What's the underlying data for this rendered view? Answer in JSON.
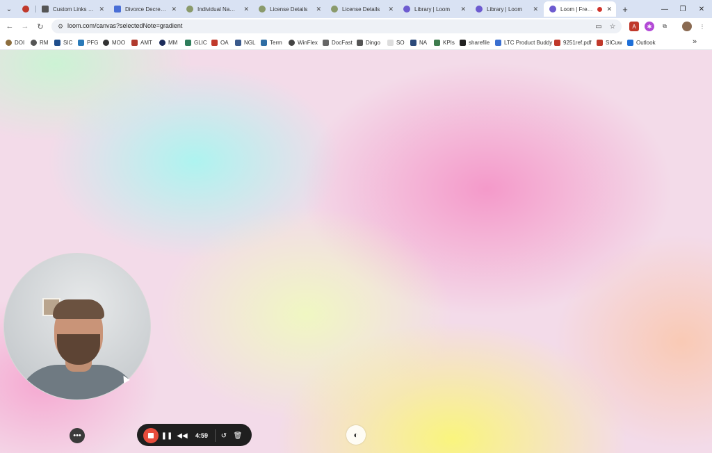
{
  "tabs": [
    {
      "title": "",
      "favicon_color": "#c0392b",
      "active": false
    },
    {
      "title": "Custom Links | DiG",
      "favicon_color": "#555555",
      "active": false
    },
    {
      "title": "Divorce Decrees and",
      "favicon_color": "#4a6fd6",
      "active": false
    },
    {
      "title": "Individual Name Se",
      "favicon_color": "#8a9a6b",
      "active": false
    },
    {
      "title": "License Details",
      "favicon_color": "#8a9a6b",
      "active": false
    },
    {
      "title": "License Details",
      "favicon_color": "#8a9a6b",
      "active": false
    },
    {
      "title": "Library | Loom",
      "favicon_color": "#6d5bd0",
      "active": false
    },
    {
      "title": "Library | Loom",
      "favicon_color": "#6d5bd0",
      "active": false
    },
    {
      "title": "Loom | Free Sc",
      "favicon_color": "#6d5bd0",
      "active": true
    }
  ],
  "tab_close_glyph": "✕",
  "new_tab_glyph": "+",
  "window": {
    "minimize": "—",
    "restore": "❐",
    "close": "✕"
  },
  "address": {
    "url": "loom.com/canvas?selectedNote=gradient"
  },
  "bookmarks": [
    {
      "label": "DOI",
      "color": "#8d6e3e"
    },
    {
      "label": "RM",
      "color": "#555555"
    },
    {
      "label": "SIC",
      "color": "#1f4e8c"
    },
    {
      "label": "PFG",
      "color": "#2a7ab8"
    },
    {
      "label": "MOO",
      "color": "#333333"
    },
    {
      "label": "AMT",
      "color": "#b03a2e"
    },
    {
      "label": "MM",
      "color": "#1b2b5a"
    },
    {
      "label": "GLIC",
      "color": "#2e7d5b"
    },
    {
      "label": "OA",
      "color": "#c0392b"
    },
    {
      "label": "NGL",
      "color": "#3a5a8c"
    },
    {
      "label": "Term",
      "color": "#2e6da4"
    },
    {
      "label": "WinFlex",
      "color": "#444444"
    },
    {
      "label": "DocFast",
      "color": "#666666"
    },
    {
      "label": "Dingo",
      "color": "#555555"
    },
    {
      "label": "SO",
      "color": "#dddddd"
    },
    {
      "label": "NA",
      "color": "#2c4a7a"
    },
    {
      "label": "KPIs",
      "color": "#3f7d4e"
    },
    {
      "label": "sharefile",
      "color": "#222222"
    },
    {
      "label": "LTC Product Buddy",
      "color": "#3a6fd0"
    },
    {
      "label": "9251ref.pdf",
      "color": "#c0392b"
    },
    {
      "label": "SICuw",
      "color": "#c0392b"
    },
    {
      "label": "Outlook",
      "color": "#1e6fd8"
    }
  ],
  "bookmarks_more": "»",
  "recorder": {
    "time": "4:59"
  },
  "cam_more": "•••"
}
